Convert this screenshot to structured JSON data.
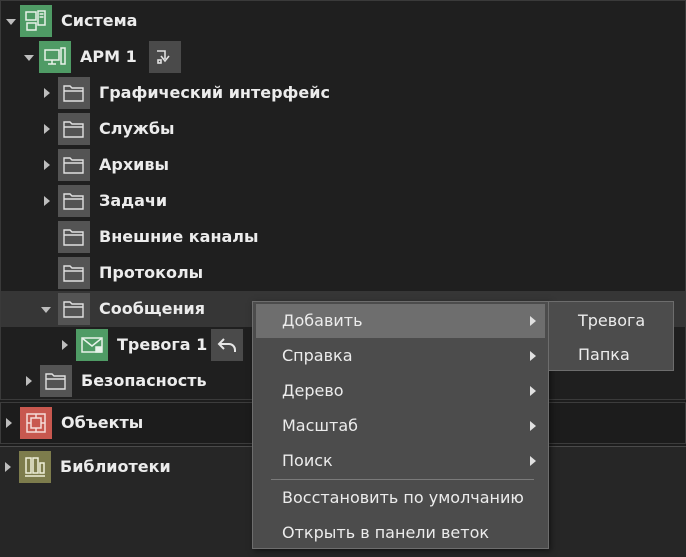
{
  "tree": {
    "system": "Система",
    "arm": "АРМ 1",
    "folders": [
      "Графический интерфейс",
      "Службы",
      "Архивы",
      "Задачи",
      "Внешние каналы",
      "Протоколы",
      "Сообщения"
    ],
    "alarm": "Тревога 1",
    "security": "Безопасность"
  },
  "panels": {
    "objects": "Объекты",
    "libraries": "Библиотеки"
  },
  "context_menu": {
    "items": [
      "Добавить",
      "Справка",
      "Дерево",
      "Масштаб",
      "Поиск"
    ],
    "restore": "Восстановить по умолчанию",
    "open_in_panel": "Открыть в панели веток"
  },
  "submenu": {
    "items": [
      "Тревога",
      "Папка"
    ]
  },
  "colors": {
    "green": "#4f9b65",
    "red": "#c8584f",
    "olive": "#7d7c4c",
    "menu_bg": "#4c4c4c",
    "menu_active": "#6e6e6e"
  }
}
